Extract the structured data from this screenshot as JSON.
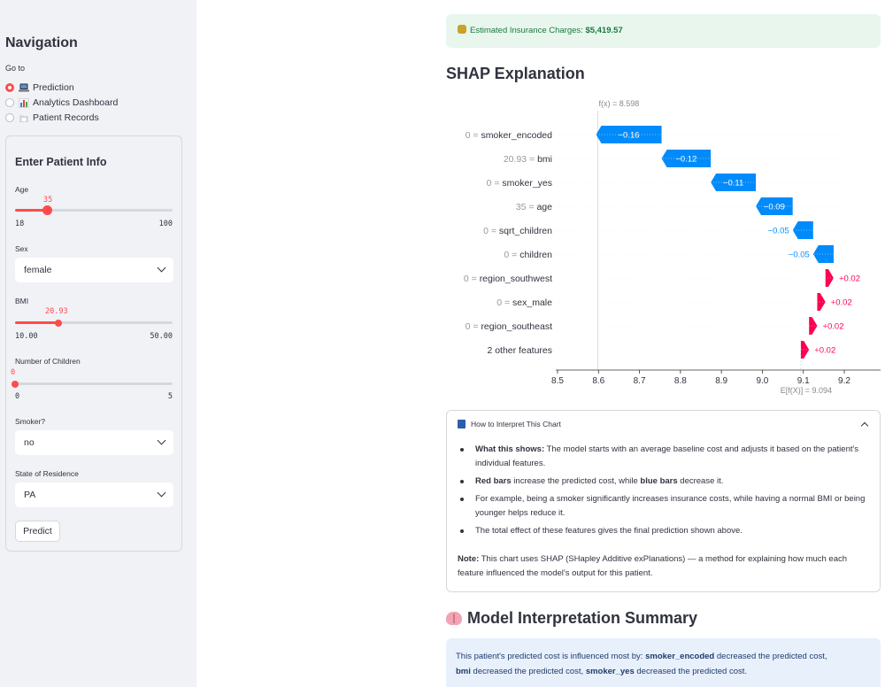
{
  "sidebar": {
    "title": "Navigation",
    "goto_label": "Go to",
    "nav_options": [
      {
        "label": "Prediction",
        "selected": true,
        "icon": "laptop-icon"
      },
      {
        "label": "Analytics Dashboard",
        "selected": false,
        "icon": "bar-chart-icon"
      },
      {
        "label": "Patient Records",
        "selected": false,
        "icon": "folder-icon"
      }
    ],
    "form": {
      "title": "Enter Patient Info",
      "age": {
        "label": "Age",
        "value": "35",
        "min": "18",
        "max": "100",
        "fraction": 0.207
      },
      "sex": {
        "label": "Sex",
        "value": "female"
      },
      "bmi": {
        "label": "BMI",
        "value": "20.93",
        "min": "10.00",
        "max": "50.00",
        "fraction": 0.273
      },
      "children": {
        "label": "Number of Children",
        "value": "0",
        "min": "0",
        "max": "5",
        "fraction": 0
      },
      "smoker": {
        "label": "Smoker?",
        "value": "no"
      },
      "state": {
        "label": "State of Residence",
        "value": "PA"
      },
      "predict_label": "Predict"
    }
  },
  "main": {
    "estimate": {
      "label": "Estimated Insurance Charges:",
      "value": "$5,419.57",
      "icon": "money-bag-icon"
    },
    "shap_heading": "SHAP Explanation",
    "expander": {
      "title": "How to Interpret This Chart",
      "icon": "book-icon",
      "bullets": [
        {
          "bold": "What this shows:",
          "text": " The model starts with an average baseline cost and adjusts it based on the patient's individual features."
        },
        {
          "bold": "Red bars",
          "text": " increase the predicted cost, while ",
          "bold2": "blue bars",
          "text2": " decrease it."
        },
        {
          "bold": "",
          "text": "For example, being a smoker significantly increases insurance costs, while having a normal BMI or being younger helps reduce it."
        },
        {
          "bold": "",
          "text": "The total effect of these features gives the final prediction shown above."
        }
      ],
      "note_bold": "Note:",
      "note_text": " This chart uses SHAP (SHapley Additive exPlanations) — a method for explaining how much each feature influenced the model's output for this patient."
    },
    "summary_heading": "Model Interpretation Summary",
    "summary_icon": "brain-icon",
    "summary": {
      "prefix": "This patient's predicted cost is influenced most by: ",
      "f1": "smoker_encoded",
      "t1": " decreased the predicted cost,",
      "f2": "bmi",
      "t2": " decreased the predicted cost, ",
      "f3": "smoker_yes",
      "t3": " decreased the predicted cost."
    }
  },
  "colors": {
    "accent": "#ff4b4b",
    "shap_positive": "#ff0051",
    "shap_negative": "#008bfb"
  },
  "chart_data": {
    "type": "waterfall",
    "fx_label": "f(x) = 8.598",
    "base_label": "E[f(X)] = 9.094",
    "fx": 8.598,
    "base_value": 9.094,
    "xlim": [
      8.5,
      9.2
    ],
    "ticks": [
      "8.5",
      "8.6",
      "8.7",
      "8.8",
      "8.9",
      "9.0",
      "9.1",
      "9.2"
    ],
    "tick_values": [
      8.5,
      8.6,
      8.7,
      8.8,
      8.9,
      9.0,
      9.1,
      9.2
    ],
    "features": [
      {
        "value": "0",
        "name": "smoker_encoded",
        "contrib": -0.16,
        "label": "−0.16"
      },
      {
        "value": "20.93",
        "name": "bmi",
        "contrib": -0.12,
        "label": "−0.12"
      },
      {
        "value": "0",
        "name": "smoker_yes",
        "contrib": -0.11,
        "label": "−0.11"
      },
      {
        "value": "35",
        "name": "age",
        "contrib": -0.09,
        "label": "−0.09"
      },
      {
        "value": "0",
        "name": "sqrt_children",
        "contrib": -0.05,
        "label": "−0.05"
      },
      {
        "value": "0",
        "name": "children",
        "contrib": -0.05,
        "label": "−0.05"
      },
      {
        "value": "0",
        "name": "region_southwest",
        "contrib": 0.02,
        "label": "+0.02"
      },
      {
        "value": "0",
        "name": "sex_male",
        "contrib": 0.02,
        "label": "+0.02"
      },
      {
        "value": "0",
        "name": "region_southeast",
        "contrib": 0.02,
        "label": "+0.02"
      },
      {
        "value": "",
        "name": "2 other features",
        "contrib": 0.02,
        "label": "+0.02"
      }
    ]
  }
}
